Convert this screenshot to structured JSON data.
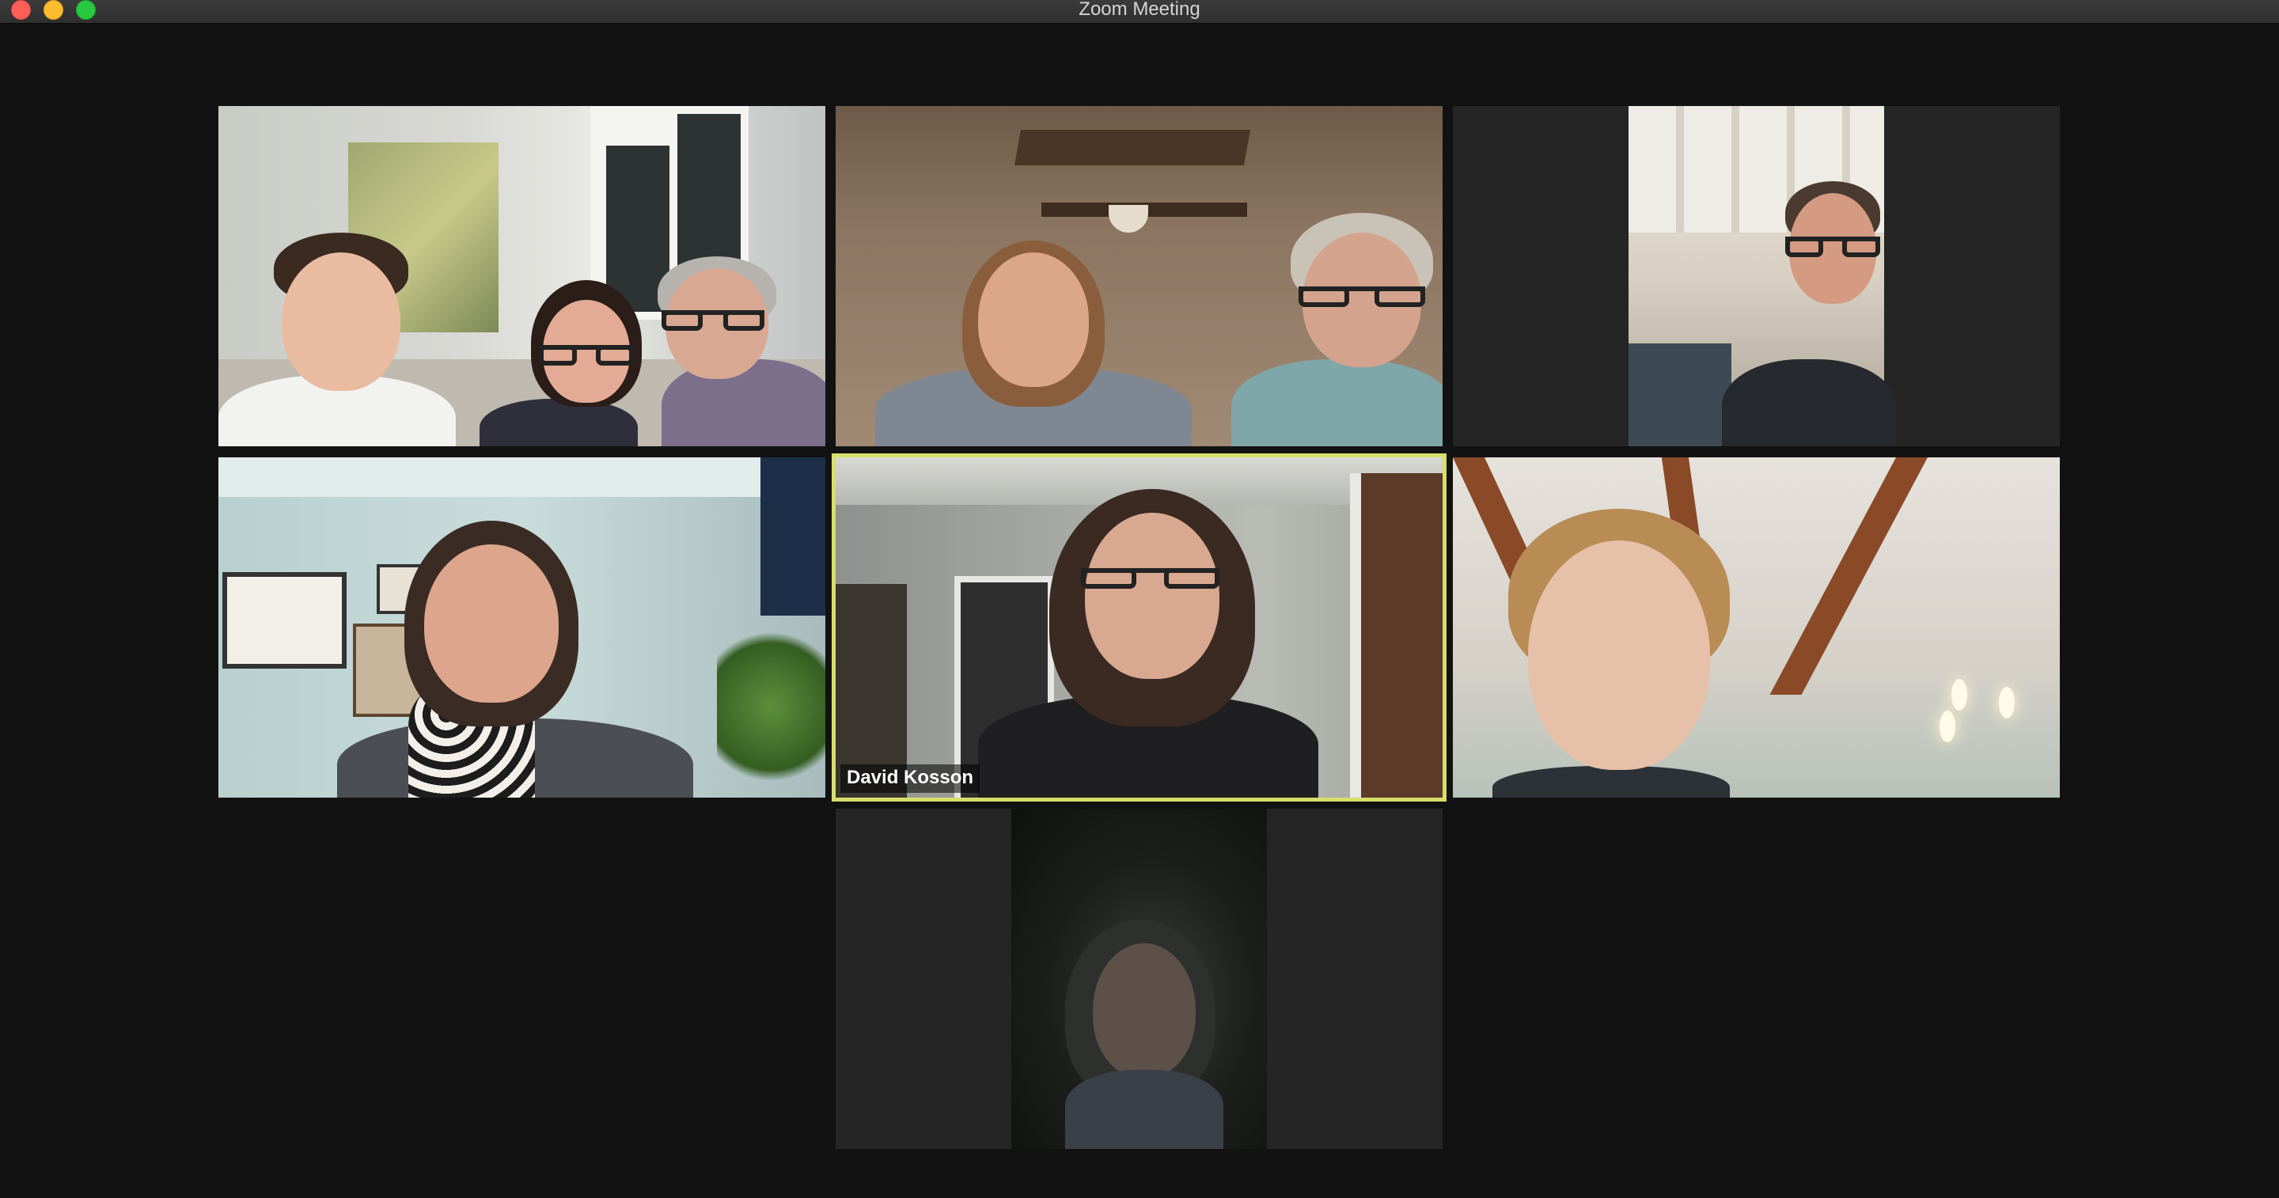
{
  "window": {
    "title": "Zoom Meeting"
  },
  "participants": [
    {
      "id": "p1",
      "description_icon": "video-feed"
    },
    {
      "id": "p2",
      "description_icon": "video-feed"
    },
    {
      "id": "p3",
      "description_icon": "video-feed"
    },
    {
      "id": "p4",
      "description_icon": "video-feed"
    },
    {
      "id": "p5",
      "name": "David Kosson",
      "active_speaker": true
    },
    {
      "id": "p6",
      "description_icon": "video-feed"
    },
    {
      "id": "p7",
      "description_icon": "video-feed"
    }
  ],
  "colors": {
    "background": "#121212",
    "active_speaker_border": "#d7de6a",
    "titlebar": "#333333"
  }
}
